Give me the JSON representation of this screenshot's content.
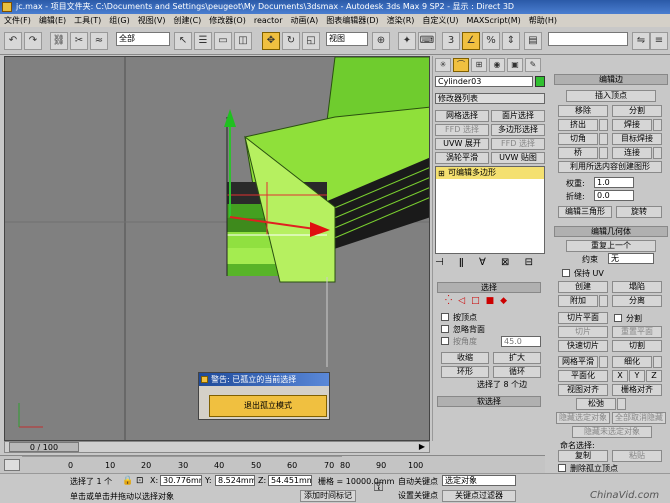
{
  "window": {
    "title": "jc.max - 项目文件夹: C:\\Documents and Settings\\peugeot\\My Documents\\3dsmax - Autodesk 3ds Max 9 SP2 - 显示 : Direct 3D"
  },
  "menu": [
    "文件(F)",
    "编辑(E)",
    "工具(T)",
    "组(G)",
    "视图(V)",
    "创建(C)",
    "修改器(O)",
    "reactor",
    "动画(A)",
    "图表编辑器(D)",
    "渲染(R)",
    "自定义(U)",
    "MAXScript(M)",
    "帮助(H)"
  ],
  "toolbar": {
    "selection_filter": "全部",
    "view_dropdown": "视图",
    "named_selection": ""
  },
  "command_panel": {
    "object_name": "Cylinder03",
    "modifier_list": "修改器列表",
    "buttons": [
      "网格选择",
      "面片选择",
      "FFD 选择",
      "多边形选择",
      "UVW 展开",
      "FFD 选择",
      "涡轮平滑",
      "UVW 贴图"
    ],
    "stack_item": "可编辑多边形",
    "selection_header": "选择",
    "by_vertex": "按顶点",
    "ignore_backface": "忽略背面",
    "by_angle": "按角度",
    "angle_value": "45.0",
    "shrink": "收缩",
    "grow": "扩大",
    "ring": "环形",
    "loop": "循环",
    "selected_status": "选择了 8 个边",
    "soft_selection": "软选择"
  },
  "edit_panel": {
    "header_edges": "编辑边",
    "insert_vertex": "插入顶点",
    "remove": "移除",
    "split": "分割",
    "extrude": "挤出",
    "weld": "焊接",
    "chamfer": "切角",
    "target_weld": "目标焊接",
    "bridge": "桥",
    "connect": "连接",
    "create_shape": "利用所选内容创建图形",
    "weight_label": "权重:",
    "weight_value": "1.0",
    "crease_label": "折缝:",
    "crease_value": "0.0",
    "edit_tri": "编辑三角形",
    "turn": "旋转",
    "header_geometry": "编辑几何体",
    "repeat_last": "重复上一个",
    "constraints_label": "约束",
    "constraints_value": "无",
    "preserve_uv": "保持 UV",
    "create": "创建",
    "collapse": "塌陷",
    "attach": "附加",
    "detach": "分离",
    "slice_plane": "切片平面",
    "split2": "分割",
    "slice": "切片",
    "reset_plane": "重置平面",
    "quick_slice": "快速切片",
    "cut": "切割",
    "meshsmooth": "网格平滑",
    "tessellate": "细化",
    "make_planar": "平面化",
    "x": "X",
    "y": "Y",
    "z": "Z",
    "view_align": "视图对齐",
    "grid_align": "栅格对齐",
    "relax": "松弛",
    "hide_selected": "隐藏选定对象",
    "unhide_all": "全部取消隐藏",
    "hide_unselected": "隐藏未选定对象",
    "named_sel": "命名选择:",
    "copy": "复制",
    "paste": "粘贴",
    "delete_isolated": "删除孤立顶点"
  },
  "viewport": {
    "label": ""
  },
  "dialog": {
    "title": "警告: 已孤立的当前选择",
    "button": "退出孤立模式"
  },
  "timeline": {
    "frame": "0 / 100"
  },
  "ruler_ticks": [
    "0",
    "10",
    "20",
    "30",
    "40",
    "50",
    "60",
    "70",
    "80",
    "90",
    "100"
  ],
  "status": {
    "selected": "选择了 1 个",
    "x_label": "X:",
    "x_value": "30.776mm",
    "y_label": "Y:",
    "y_value": "8.524mm",
    "z_label": "Z:",
    "z_value": "54.451mm",
    "grid": "栅格 = 10000.0mm",
    "prompt": "单击或单击并拖动以选择对象",
    "add_time_tag": "添加时间标记",
    "auto_key": "自动关键点",
    "set_key": "设置关键点",
    "key_filter_sel": "选定对象",
    "key_filters": "关键点过滤器",
    "watermark": "ChinaVid.com"
  }
}
